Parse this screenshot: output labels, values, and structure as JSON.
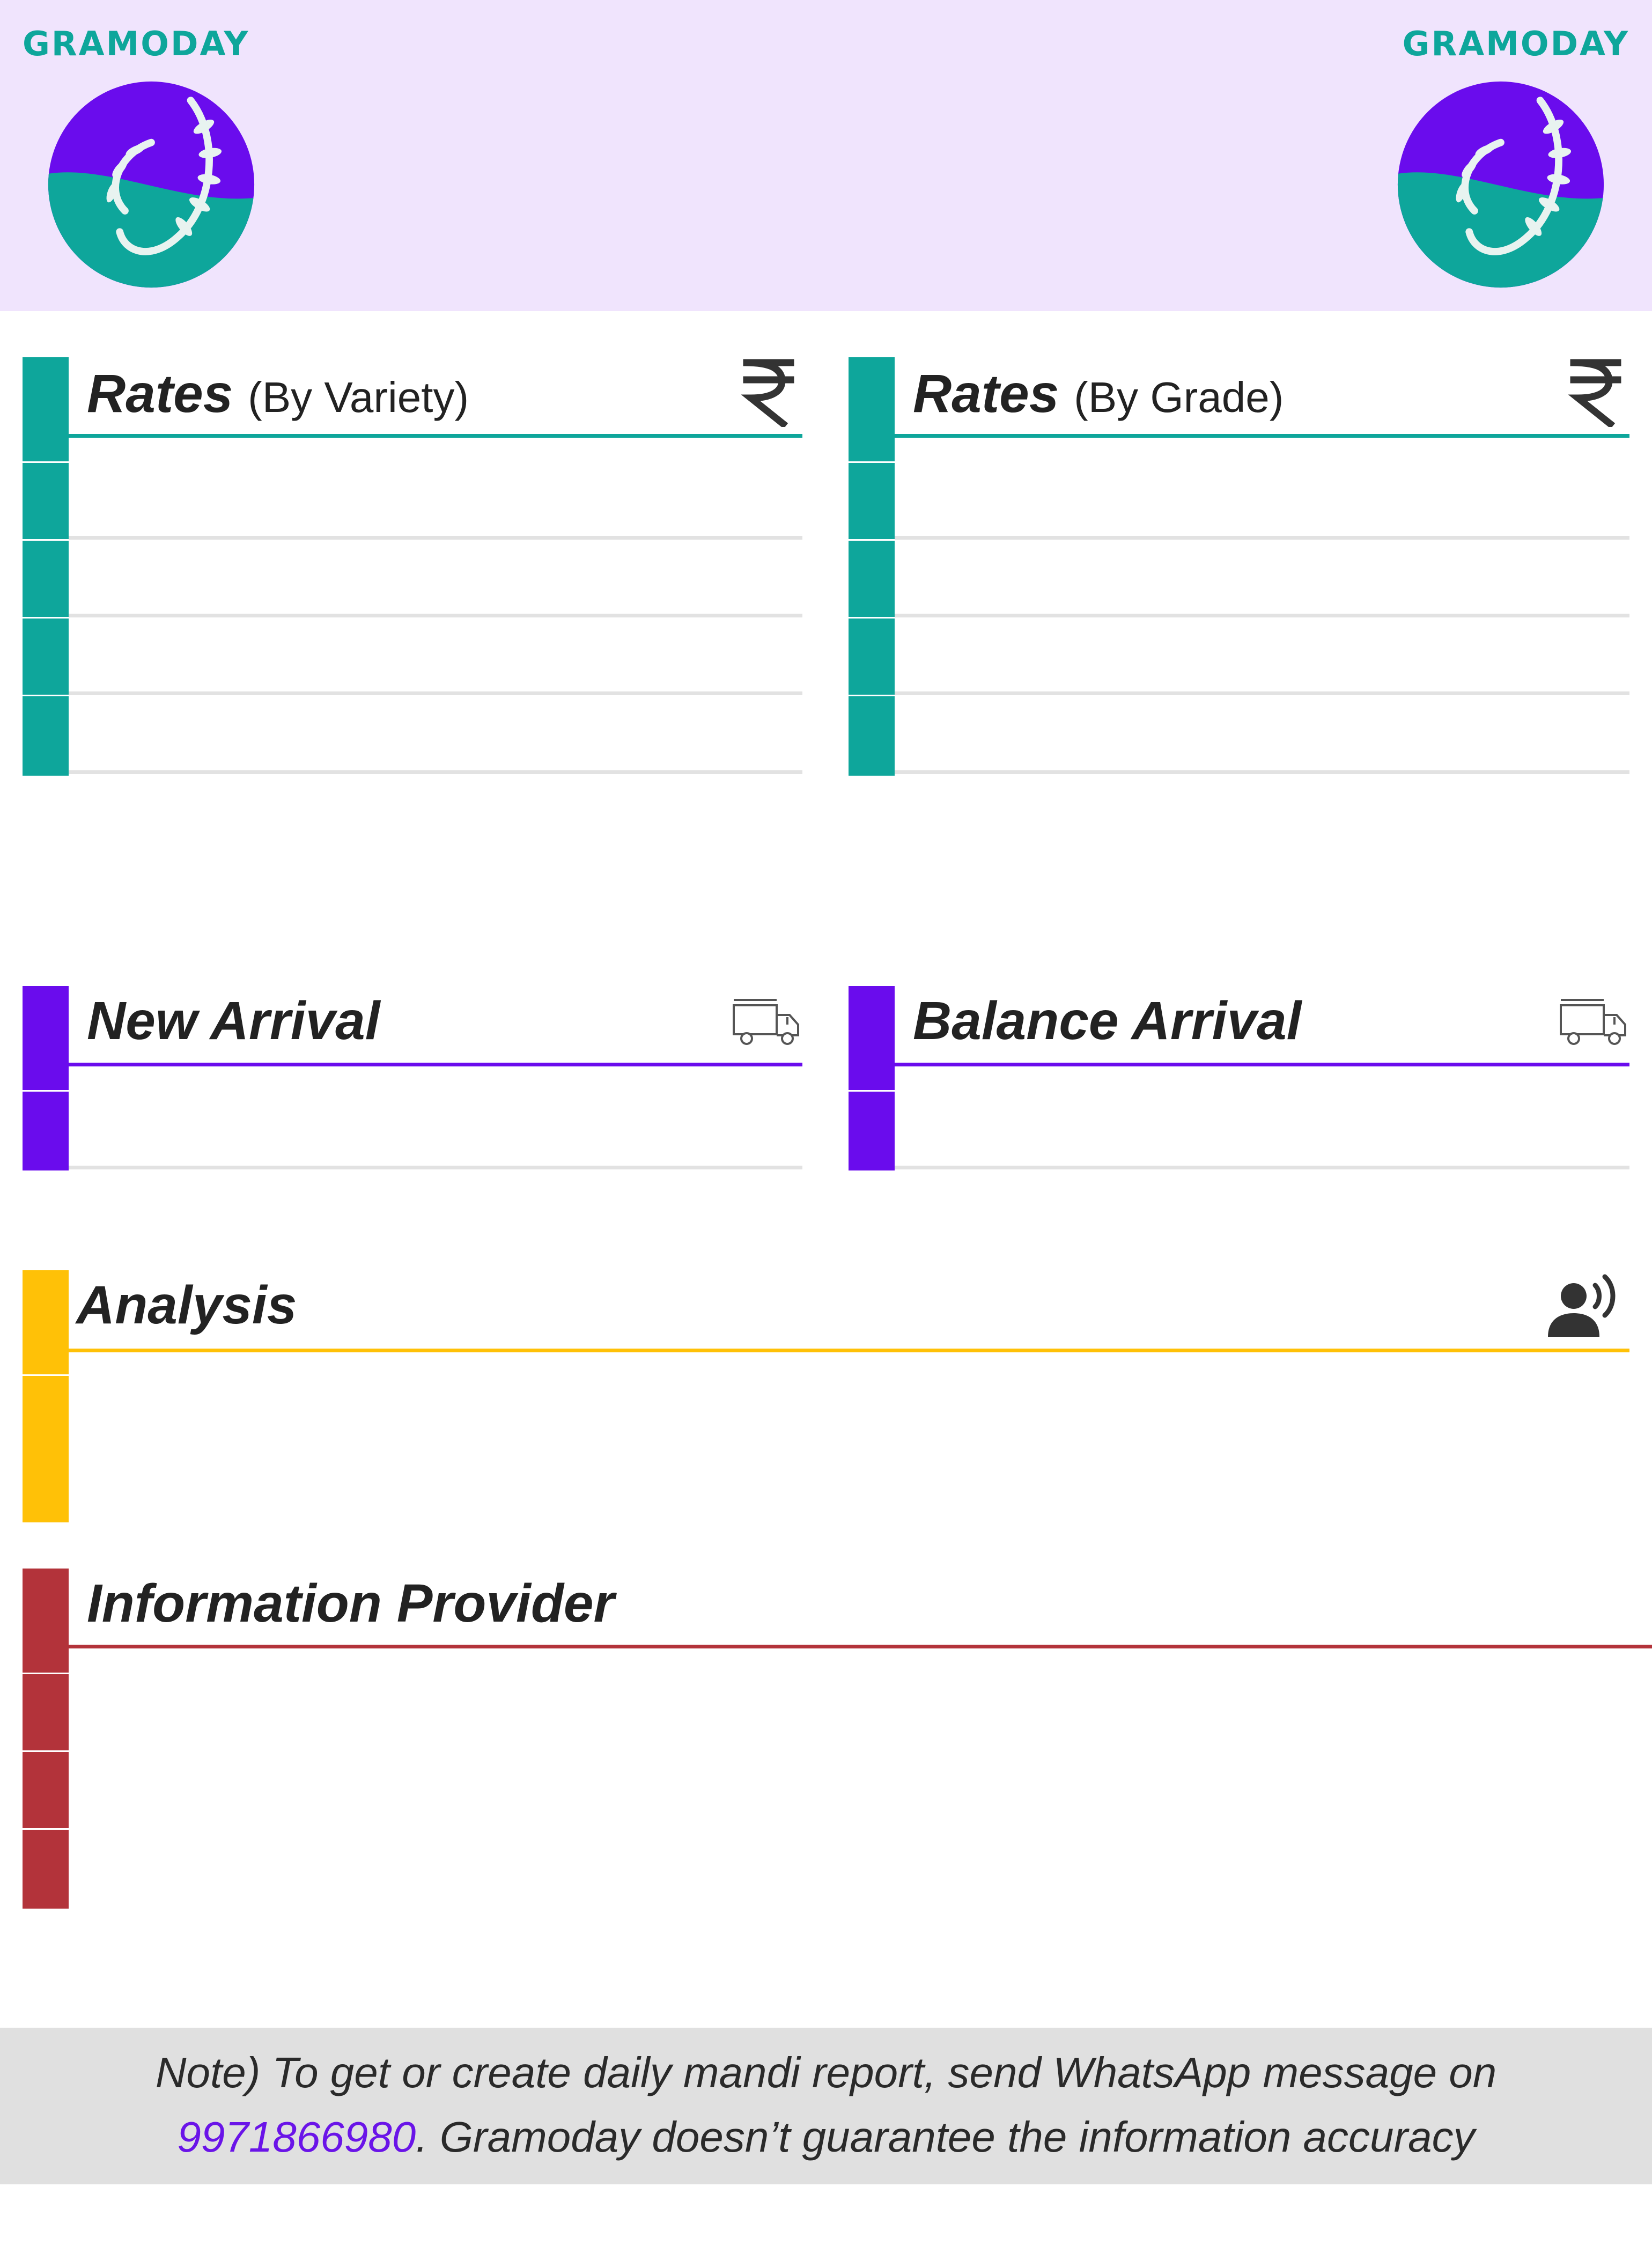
{
  "header": {
    "brand_left": "GRAMODAY",
    "brand_right": "GRAMODAY",
    "logo_icon": "gramoday-wheat-logo-icon"
  },
  "sections": {
    "rates_variety": {
      "title": "Rates",
      "subtitle": "(By Variety)",
      "icon": "rupee-icon",
      "color": "#0ea69b"
    },
    "rates_grade": {
      "title": "Rates",
      "subtitle": "(By Grade)",
      "icon": "rupee-icon",
      "color": "#0ea69b"
    },
    "new_arrival": {
      "title": "New Arrival",
      "icon": "truck-icon",
      "color": "#6a0ced"
    },
    "balance_arrival": {
      "title": "Balance Arrival",
      "icon": "truck-icon",
      "color": "#6a0ced"
    },
    "analysis": {
      "title": "Analysis",
      "icon": "speaking-person-icon",
      "color": "#ffc107"
    },
    "information_provider": {
      "title": "Information Provider",
      "color": "#b3333a"
    }
  },
  "footer": {
    "line1": "Note) To get or create daily mandi report, send WhatsApp message on",
    "phone": "9971866980",
    "line2_rest": ". Gramoday doesn’t guarantee the information accuracy"
  },
  "colors": {
    "header_bg": "#f0e4fd",
    "teal": "#0ea69b",
    "purple": "#6a0ced",
    "yellow": "#ffc107",
    "red": "#b3333a",
    "footer_bg": "#e0e0e0"
  }
}
